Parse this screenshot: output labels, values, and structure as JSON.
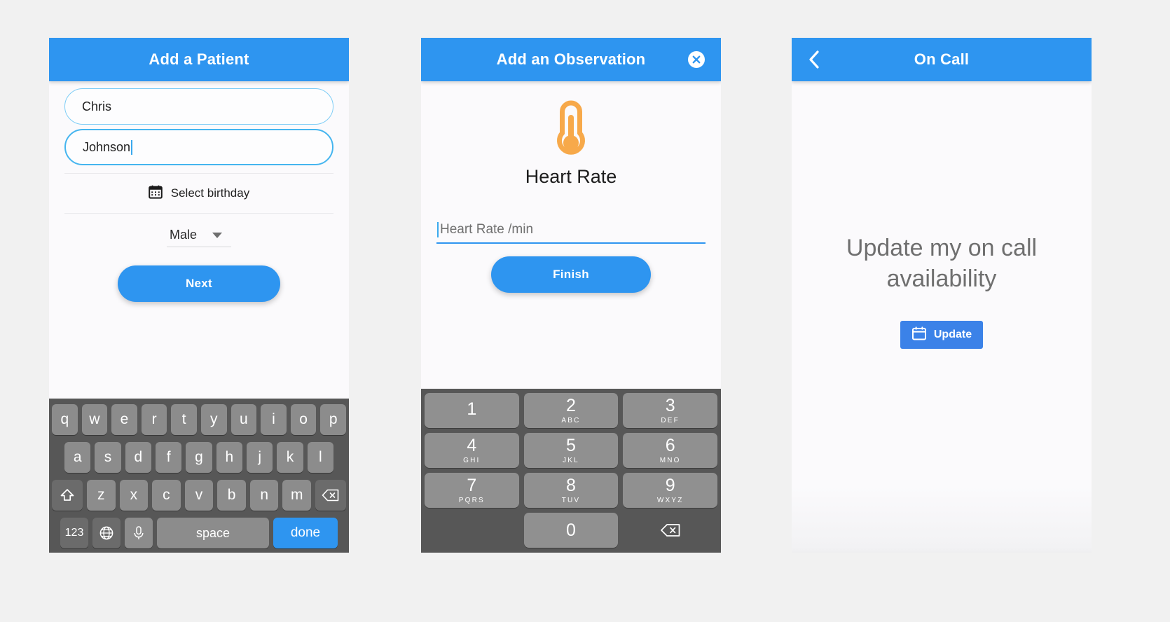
{
  "screens": {
    "add_patient": {
      "title": "Add a Patient",
      "first_name_value": "Chris",
      "last_name_value": "Johnson",
      "birthday_label": "Select birthday",
      "gender_value": "Male",
      "next_label": "Next",
      "keyboard": {
        "row1": [
          "q",
          "w",
          "e",
          "r",
          "t",
          "y",
          "u",
          "i",
          "o",
          "p"
        ],
        "row2": [
          "a",
          "s",
          "d",
          "f",
          "g",
          "h",
          "j",
          "k",
          "l"
        ],
        "row3": [
          "z",
          "x",
          "c",
          "v",
          "b",
          "n",
          "m"
        ],
        "numbers_label": "123",
        "space_label": "space",
        "done_label": "done"
      }
    },
    "observation": {
      "title": "Add an Observation",
      "measure_label": "Heart Rate",
      "input_placeholder": "Heart Rate /min",
      "finish_label": "Finish",
      "numpad": [
        {
          "digit": "1",
          "letters": ""
        },
        {
          "digit": "2",
          "letters": "ABC"
        },
        {
          "digit": "3",
          "letters": "DEF"
        },
        {
          "digit": "4",
          "letters": "GHI"
        },
        {
          "digit": "5",
          "letters": "JKL"
        },
        {
          "digit": "6",
          "letters": "MNO"
        },
        {
          "digit": "7",
          "letters": "PQRS"
        },
        {
          "digit": "8",
          "letters": "TUV"
        },
        {
          "digit": "9",
          "letters": "WXYZ"
        },
        {
          "digit": "0",
          "letters": ""
        }
      ]
    },
    "on_call": {
      "title": "On Call",
      "heading": "Update my on call availability",
      "update_label": "Update"
    }
  },
  "colors": {
    "accent_blue": "#2e95f0",
    "update_blue": "#3b82e8",
    "thermometer_orange": "#f7a94a",
    "panel_bg": "#fbfafc",
    "page_bg": "#f1f1f1",
    "keyboard_bg": "#575757",
    "key_bg": "#8c8c8c"
  }
}
